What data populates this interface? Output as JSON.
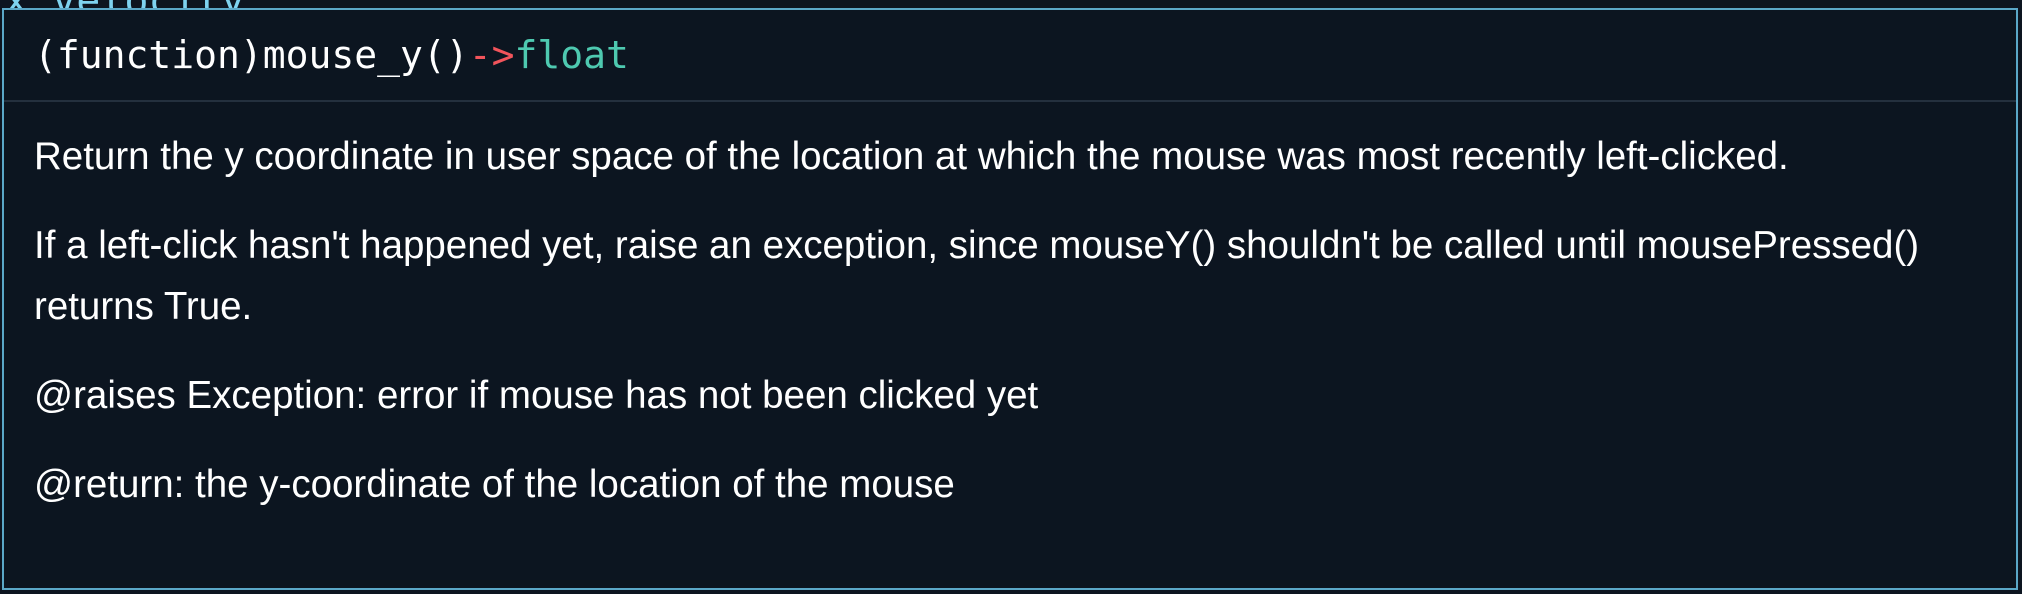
{
  "background_code": "x_velocity",
  "signature": {
    "kind": "(function)",
    "name": "mouse_y()",
    "arrow": "->",
    "return_type": "float"
  },
  "doc": {
    "paragraphs": [
      "Return the y coordinate in user space of the location at which the mouse was most recently left-clicked.",
      "If a left-click hasn't happened yet, raise an exception, since mouseY() shouldn't be called until mousePressed() returns True.",
      "@raises Exception: error if mouse has not been clicked yet",
      "@return: the y-coordinate of the location of the mouse"
    ]
  }
}
